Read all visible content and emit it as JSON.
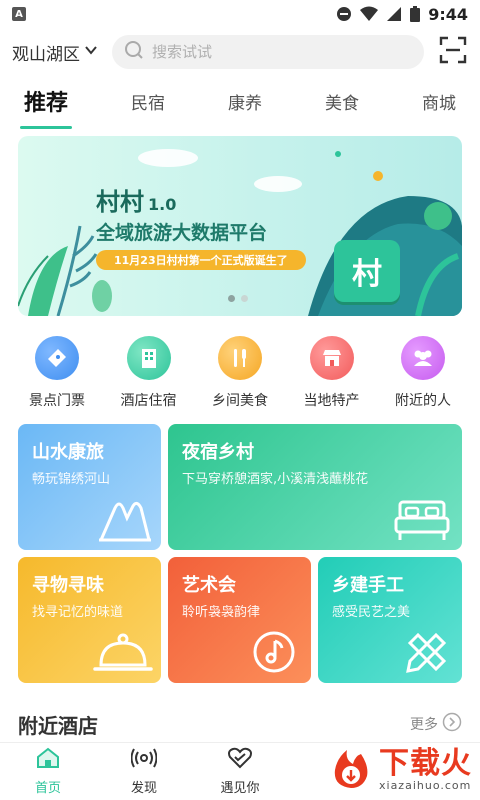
{
  "status_bar": {
    "time": "9:44",
    "left_badge": "A"
  },
  "header": {
    "location": "观山湖区",
    "search_placeholder": "搜索试试"
  },
  "tabs": [
    {
      "label": "推荐",
      "active": true
    },
    {
      "label": "民宿",
      "active": false
    },
    {
      "label": "康养",
      "active": false
    },
    {
      "label": "美食",
      "active": false
    },
    {
      "label": "商城",
      "active": false
    }
  ],
  "banner": {
    "title": "村村",
    "version": "1.0",
    "subtitle": "全域旅游大数据平台",
    "tag": "11月23日村村第一个正式版诞生了",
    "badge": "村",
    "slide_count": 2,
    "active_slide": 1
  },
  "categories": [
    {
      "label": "景点门票",
      "icon": "ticket-icon",
      "color": "#3f8ef0"
    },
    {
      "label": "酒店住宿",
      "icon": "hotel-icon",
      "color": "#2dc49a"
    },
    {
      "label": "乡间美食",
      "icon": "cutlery-icon",
      "color": "#f5a623"
    },
    {
      "label": "当地特产",
      "icon": "shop-icon",
      "color": "#f25b5b"
    },
    {
      "label": "附近的人",
      "icon": "people-icon",
      "color": "#c65bef"
    }
  ],
  "cards": [
    {
      "title": "山水康旅",
      "subtitle": "畅玩锦绣河山",
      "icon": "mountain-icon",
      "color_from": "#6bb8f5",
      "color_to": "#9ecffa"
    },
    {
      "title": "夜宿乡村",
      "subtitle": "下马穿桥憩酒家,小溪清浅蘸桃花",
      "icon": "bed-icon",
      "color_from": "#2ec58f",
      "color_to": "#6ee0c1"
    },
    {
      "title": "寻物寻味",
      "subtitle": "找寻记忆的味道",
      "icon": "dish-cover-icon",
      "color_from": "#f6b92c",
      "color_to": "#fbd25e"
    },
    {
      "title": "艺术会",
      "subtitle": "聆听袅袅韵律",
      "icon": "music-icon",
      "color_from": "#f2603a",
      "color_to": "#fb8a55"
    },
    {
      "title": "乡建手工",
      "subtitle": "感受民艺之美",
      "icon": "pencil-ruler-icon",
      "color_from": "#22cdb7",
      "color_to": "#5de0d0"
    }
  ],
  "nearby": {
    "title": "附近酒店",
    "more_label": "更多"
  },
  "bottom_nav": [
    {
      "label": "首页",
      "icon": "home-icon",
      "active": true
    },
    {
      "label": "发现",
      "icon": "broadcast-icon",
      "active": false
    },
    {
      "label": "遇见你",
      "icon": "heart-icon",
      "active": false
    }
  ],
  "watermark": {
    "text": "下载火",
    "url_text": "xiazaihuo.com"
  }
}
